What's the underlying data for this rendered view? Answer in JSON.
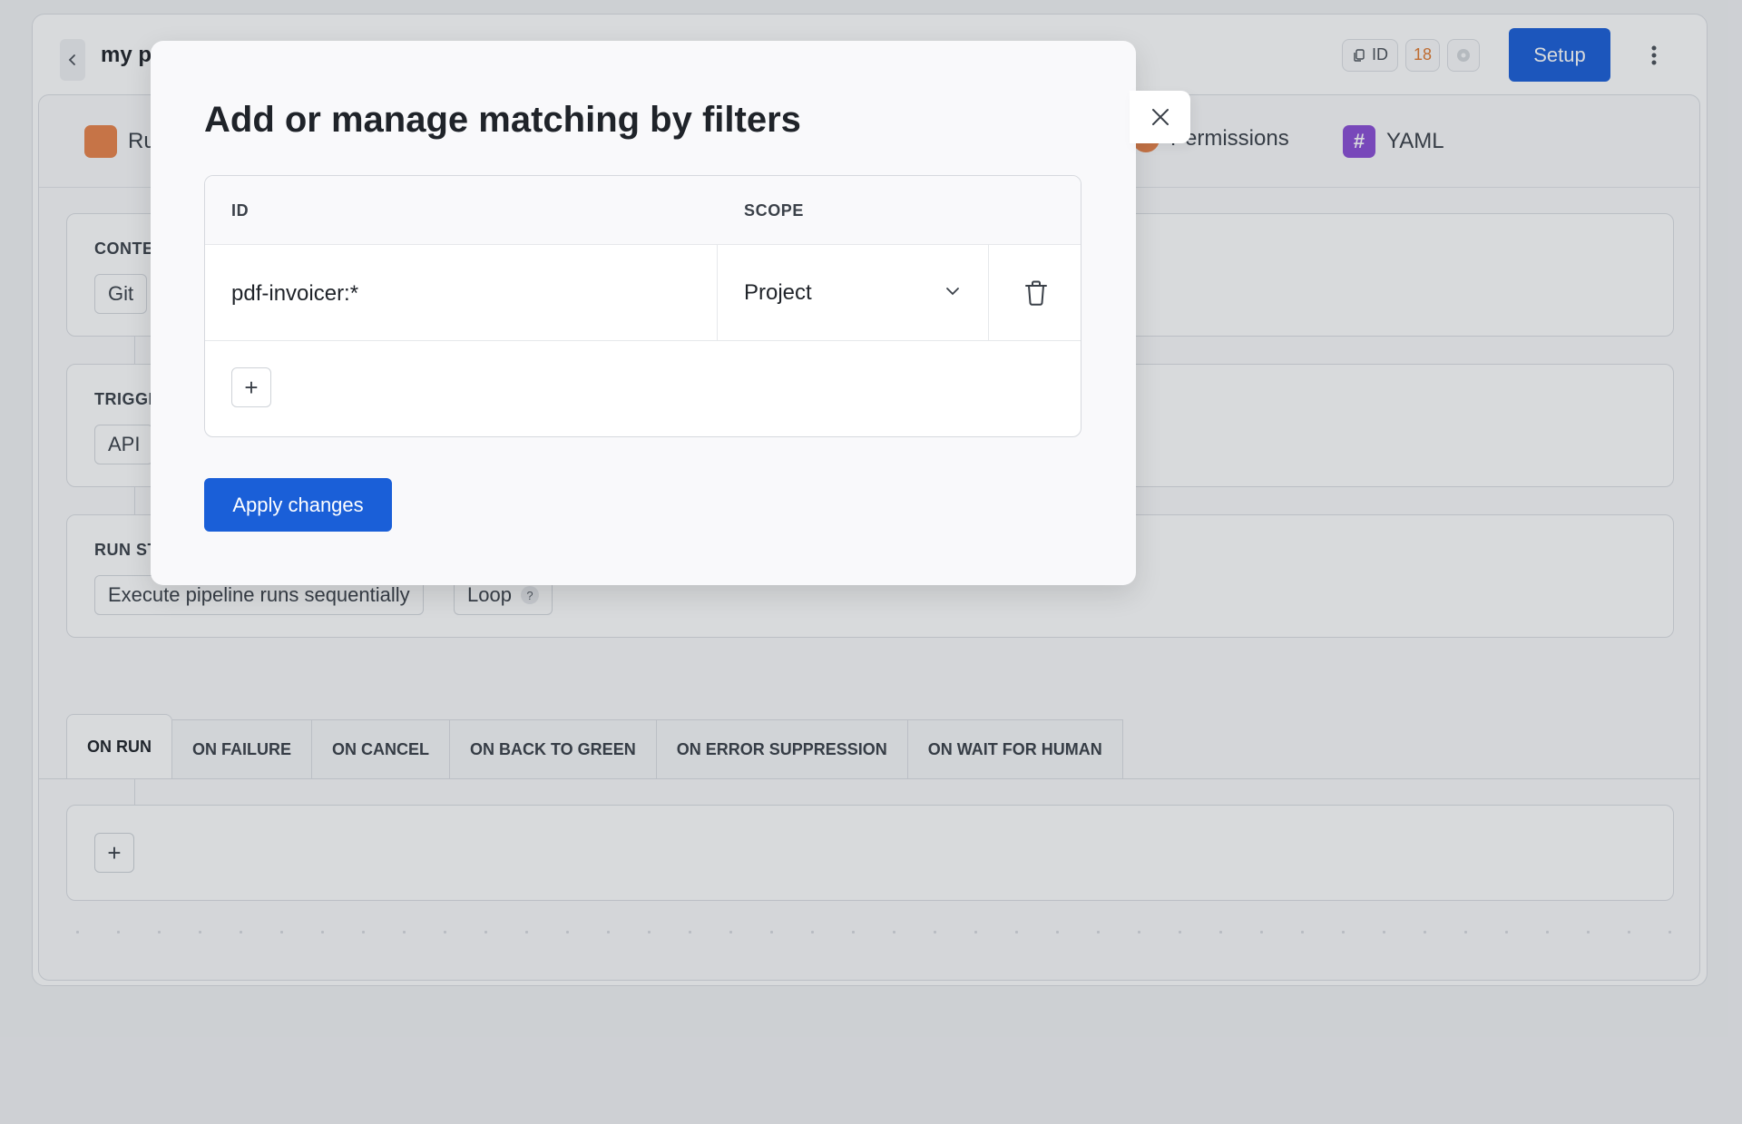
{
  "header": {
    "title": "my p",
    "id_chip_label": "ID",
    "count_badge": "18",
    "setup_label": "Setup"
  },
  "top_tabs": [
    {
      "label": "Ru",
      "icon": "runs-icon"
    },
    {
      "label": "Permissions",
      "icon": "permissions-icon"
    },
    {
      "label": "YAML",
      "icon": "hash-icon"
    }
  ],
  "sections": {
    "context": {
      "label": "CONTE",
      "pill": "Git"
    },
    "triggers": {
      "label": "TRIGGE",
      "pill": "API"
    },
    "run_strategy": {
      "label": "RUN ST",
      "pill_sequential": "Execute pipeline runs sequentially",
      "pill_loop": "Loop",
      "help_glyph": "?"
    }
  },
  "event_tabs": [
    "ON RUN",
    "ON FAILURE",
    "ON CANCEL",
    "ON BACK TO GREEN",
    "ON ERROR SUPPRESSION",
    "ON WAIT FOR HUMAN"
  ],
  "modal": {
    "title": "Add or manage matching by filters",
    "columns": {
      "id": "ID",
      "scope": "SCOPE"
    },
    "rows": [
      {
        "id": "pdf-invoicer:*",
        "scope": "Project"
      }
    ],
    "add_row_glyph": "+",
    "apply_label": "Apply changes"
  },
  "colors": {
    "primary": "#1a5fd8",
    "orange": "#e9834a",
    "purple": "#8a4dd6"
  }
}
